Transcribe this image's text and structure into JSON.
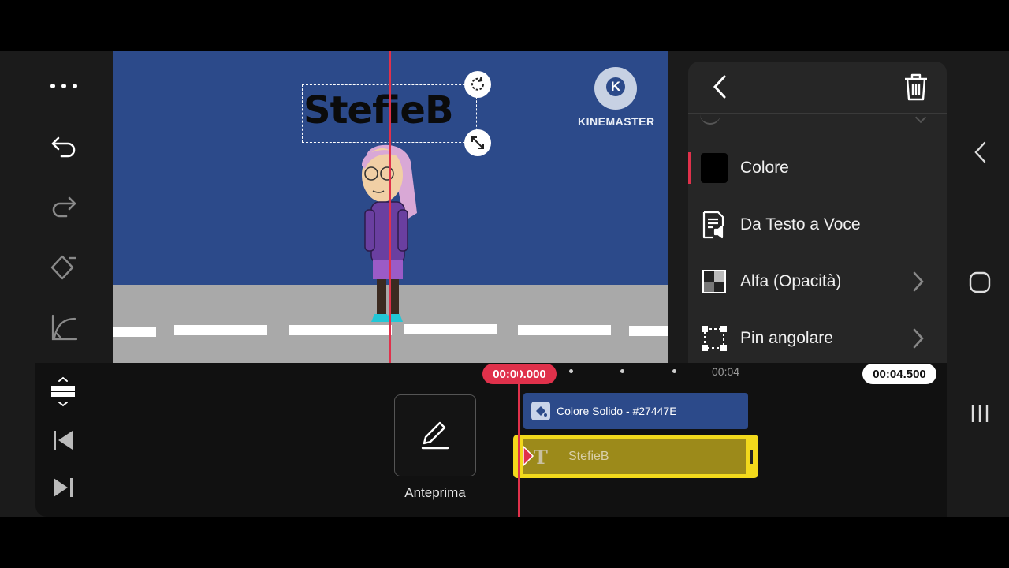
{
  "preview": {
    "overlay_text": "StefieB",
    "watermark_text": "KINEMASTER",
    "background_color": "#27447E",
    "road_color": "#A9A9A9"
  },
  "left_tools": [
    {
      "name": "more-menu",
      "icon": "ellipsis-icon"
    },
    {
      "name": "undo",
      "icon": "undo-icon"
    },
    {
      "name": "redo",
      "icon": "redo-icon"
    },
    {
      "name": "keyframe",
      "icon": "keyframe-icon"
    },
    {
      "name": "speed-curve",
      "icon": "curve-icon"
    }
  ],
  "panel": {
    "back_icon": "chevron-left-icon",
    "delete_icon": "trash-icon",
    "items": [
      {
        "label": "Colore",
        "icon": "color-swatch-icon",
        "swatch": "#000000",
        "has_chevron": false
      },
      {
        "label": "Da Testo a Voce",
        "icon": "text-to-speech-icon",
        "has_chevron": false
      },
      {
        "label": "Alfa (Opacità)",
        "icon": "alpha-checker-icon",
        "has_chevron": true
      },
      {
        "label": "Pin angolare",
        "icon": "corner-pin-icon",
        "has_chevron": true
      }
    ]
  },
  "timeline": {
    "current_time": "00:00.000",
    "tick_label": "00:04",
    "total_time": "00:04.500",
    "preview_button_label": "Anteprima",
    "clips": [
      {
        "label": "Colore Solido - #27447E",
        "icon": "paint-bucket-icon",
        "color": "#2C4A8A"
      },
      {
        "label": "StefieB",
        "icon": "text-layer-icon",
        "color": "#F2D91C"
      }
    ]
  },
  "accent_color": "#E0314B"
}
